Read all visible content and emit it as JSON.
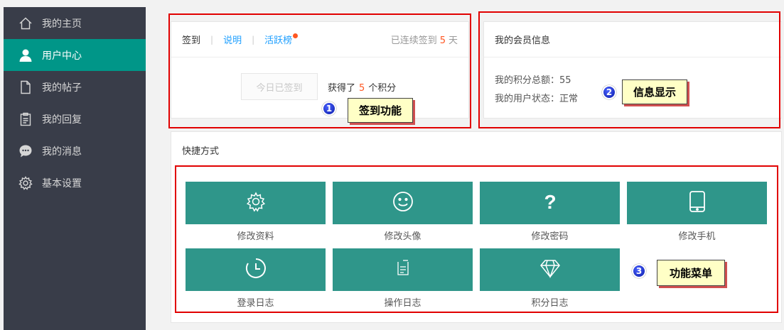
{
  "sidebar": {
    "items": [
      {
        "label": "我的主页",
        "icon": "home-icon",
        "active": false
      },
      {
        "label": "用户中心",
        "icon": "user-icon",
        "active": true
      },
      {
        "label": "我的帖子",
        "icon": "document-icon",
        "active": false
      },
      {
        "label": "我的回复",
        "icon": "clipboard-icon",
        "active": false
      },
      {
        "label": "我的消息",
        "icon": "chat-bubble-icon",
        "active": false
      },
      {
        "label": "基本设置",
        "icon": "gear-icon",
        "active": false
      }
    ]
  },
  "signin": {
    "tabs": [
      "签到",
      "说明",
      "活跃榜"
    ],
    "streak_prefix": "已连续签到",
    "streak_days": "5",
    "streak_suffix": "天",
    "button_label": "今日已签到",
    "earned_prefix": "获得了",
    "earned_points": "5",
    "earned_suffix": "个积分"
  },
  "member": {
    "title": "我的会员信息",
    "points_line": "我的积分总额：55",
    "status_line": "我的用户状态：正常"
  },
  "quick": {
    "title": "快捷方式",
    "items": [
      {
        "label": "修改资料",
        "icon": "gear-icon"
      },
      {
        "label": "修改头像",
        "icon": "smiley-icon"
      },
      {
        "label": "修改密码",
        "icon": "question-icon"
      },
      {
        "label": "修改手机",
        "icon": "tablet-icon"
      },
      {
        "label": "登录日志",
        "icon": "clock-icon"
      },
      {
        "label": "操作日志",
        "icon": "log-icon"
      },
      {
        "label": "积分日志",
        "icon": "diamond-icon"
      }
    ]
  },
  "annotations": [
    {
      "number": "1",
      "label": "签到功能"
    },
    {
      "number": "2",
      "label": "信息显示"
    },
    {
      "number": "3",
      "label": "功能菜单"
    }
  ],
  "colors": {
    "sidebar_bg": "#393d49",
    "active": "#009688",
    "tile": "#2f968a",
    "accent": "#ff5722",
    "link": "#1e9fff",
    "annotation_red": "#e10000"
  }
}
